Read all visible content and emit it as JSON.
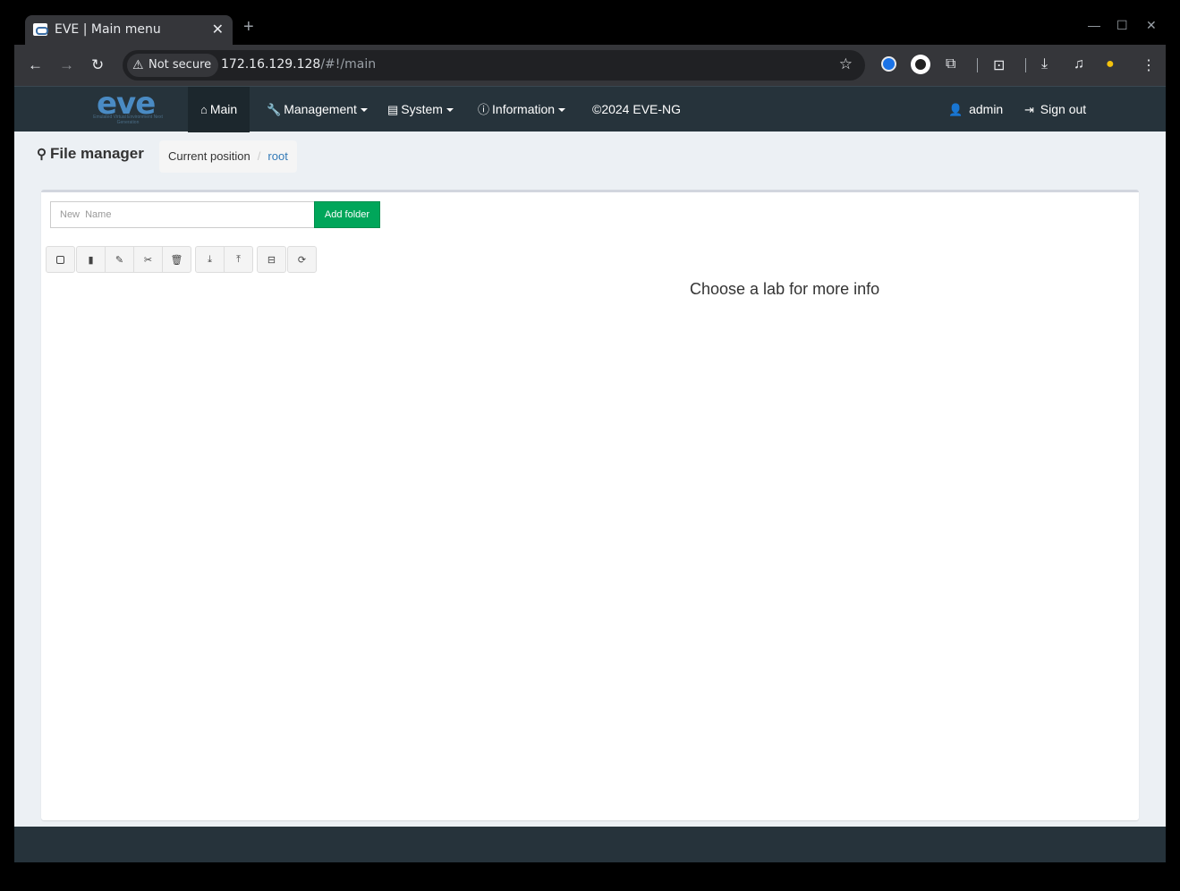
{
  "browser": {
    "tab_title": "EVE | Main menu",
    "tab_close": "✕",
    "new_tab": "+",
    "security_label": "Not secure",
    "url_host": "172.16.129.128",
    "url_path": "/#!/main"
  },
  "navbar": {
    "logo_text": "eve",
    "logo_subtitle": "Emulated Virtual Environment Next Generation",
    "items": [
      {
        "label": "Main",
        "icon": "home-icon"
      },
      {
        "label": "Management",
        "icon": "wrench-icon"
      },
      {
        "label": "System",
        "icon": "book-icon"
      },
      {
        "label": "Information",
        "icon": "info-icon"
      },
      {
        "label": "©2024 EVE-NG"
      }
    ],
    "user": "admin",
    "signout": "Sign out"
  },
  "file_manager": {
    "title": "File manager",
    "breadcrumb_label": "Current position",
    "breadcrumb_root": "root",
    "new_name_placeholder": "New  Name",
    "add_folder_label": "Add folder",
    "toolbar_icons": [
      "select-all-icon",
      "new-file-icon",
      "rename-icon",
      "cut-icon",
      "delete-icon",
      "import-icon",
      "export-icon",
      "archive-icon",
      "refresh-icon"
    ]
  },
  "info_panel": {
    "message": "Choose a lab for more info"
  },
  "colors": {
    "navbar": "#26333b",
    "add_button": "#00a65a",
    "link": "#337ab7"
  }
}
